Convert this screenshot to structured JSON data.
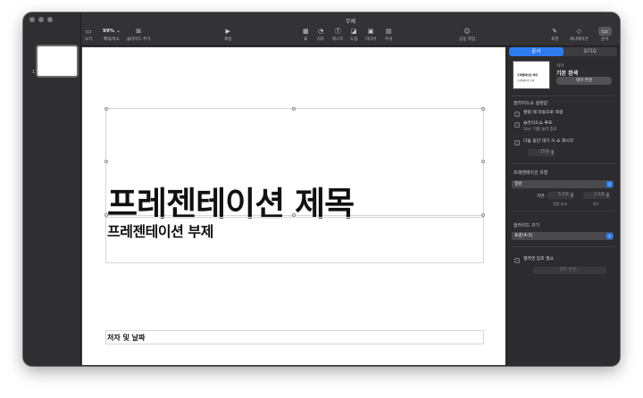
{
  "window": {
    "title": "무제"
  },
  "toolbar": {
    "view_label": "보기",
    "zoom_value": "99%",
    "zoom_label": "확대/축소",
    "add_slide_label": "슬라이드 추가",
    "play_label": "재생",
    "table_label": "표",
    "chart_label": "차트",
    "text_label": "텍스트",
    "shape_label": "도형",
    "media_label": "미디어",
    "comment_label": "주석",
    "collaborate_label": "공동 작업",
    "format_label": "포맷",
    "animate_label": "애니메이션",
    "document_label": "문서"
  },
  "navigator": {
    "slide_number": "1"
  },
  "slide": {
    "title": "프레젠테이션 제목",
    "subtitle": "프레젠테이션 부제",
    "author": "저자 및 날짜"
  },
  "inspector": {
    "tabs": [
      "문서",
      "오디오"
    ],
    "theme": {
      "label": "테마",
      "name": "기본 흰색",
      "change_button": "테마 변경",
      "thumb_title": "프레젠테이션 제목",
      "thumb_subtitle": "프레젠테이션 부제"
    },
    "slideshow_settings": {
      "heading": "슬라이드쇼 설정값",
      "autoplay": "열릴 때 자동으로 재생",
      "loop": "슬라이드쇼 루프",
      "loop_sub": "'Esc' 키를 눌러 종료",
      "restart": "다음 동안 대기 시 쇼 재시작",
      "restart_value": "15분"
    },
    "presentation_type": {
      "heading": "프레젠테이션 유형",
      "value": "일반",
      "delay_label": "지연:",
      "transition_value": "5.0초",
      "transition_label": "전환 효과",
      "build_value": "2.0초",
      "build_label": "빌드"
    },
    "slide_size": {
      "heading": "슬라이드 크기",
      "value": "표준(4:3)"
    },
    "password": {
      "label": "열려면 암호 필요",
      "button": "암호 변경..."
    }
  },
  "colors": {
    "accent": "#2d7bf0",
    "toolbar_bg": "#333335",
    "inspector_bg": "#2c2c2e",
    "slide_bg": "#ffffff"
  }
}
